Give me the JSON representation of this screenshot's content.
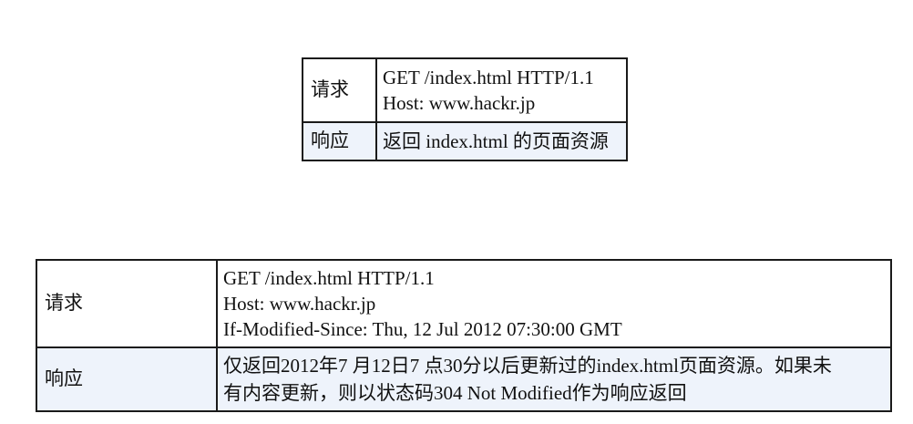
{
  "table_1": {
    "request_label": "请求",
    "request_lines": [
      "GET /index.html HTTP/1.1",
      "Host: www.hackr.jp"
    ],
    "response_label": "响应",
    "response_text": "返回 index.html 的页面资源"
  },
  "table_2": {
    "request_label": "请求",
    "request_lines": [
      "GET /index.html HTTP/1.1",
      "Host: www.hackr.jp",
      "If-Modified-Since: Thu, 12 Jul 2012 07:30:00 GMT"
    ],
    "response_label": "响应",
    "response_lines": [
      "仅返回2012年7 月12日7 点30分以后更新过的index.html页面资源。如果未",
      "有内容更新，则以状态码304 Not Modified作为响应返回"
    ]
  },
  "colors": {
    "border": "#1a1a1a",
    "response_row_bg": "#eef3fb"
  }
}
